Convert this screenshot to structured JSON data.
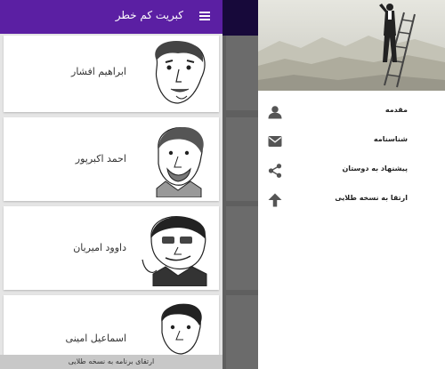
{
  "app": {
    "title": "کبریت کم خطر"
  },
  "list": {
    "items": [
      {
        "name": "ابراهیم افشار"
      },
      {
        "name": "احمد اکبرپور"
      },
      {
        "name": "داوود امیریان"
      },
      {
        "name": "اسماعیل امینی"
      }
    ]
  },
  "footer": {
    "upgrade_label": "ارتقای برنامه به نسخه طلایی"
  },
  "drawer": {
    "items": [
      {
        "label": "مقدمه",
        "icon": "person-icon"
      },
      {
        "label": "شناسنامه",
        "icon": "mail-icon"
      },
      {
        "label": "پیشنهاد به دوستان",
        "icon": "share-icon"
      },
      {
        "label": "ارتقا به نسخه طلایی",
        "icon": "arrow-up-icon"
      }
    ]
  },
  "colors": {
    "app_bar": "#5b1fa3",
    "drawer_icon": "#555555"
  }
}
